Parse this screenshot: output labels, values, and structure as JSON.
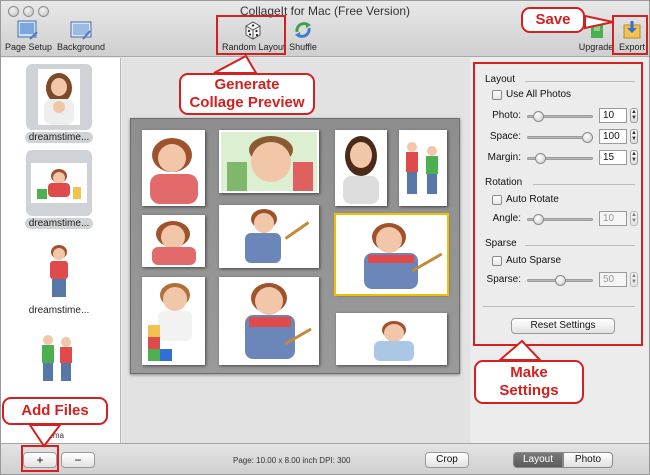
{
  "window": {
    "title": "CollageIt for Mac (Free Version)"
  },
  "toolbar": {
    "page_setup": "Page Setup",
    "background": "Background",
    "random_layout": "Random Layout",
    "shuffle": "Shuffle",
    "upgrade": "Upgrade",
    "export": "Export"
  },
  "sidebar": {
    "items": [
      {
        "label": "dreamstime..."
      },
      {
        "label": "dreamstime..."
      },
      {
        "label": "dreamstime..."
      }
    ],
    "count_label": "6 Ima",
    "add_button": "+",
    "remove_button": "−"
  },
  "settings": {
    "layout_header": "Layout",
    "use_all_photos": "Use All Photos",
    "photo_label": "Photo:",
    "photo_value": "10",
    "photo_level": 0.1,
    "space_label": "Space:",
    "space_value": "100",
    "space_level": 1.0,
    "margin_label": "Margin:",
    "margin_value": "15",
    "margin_level": 0.15,
    "rotation_header": "Rotation",
    "auto_rotate": "Auto Rotate",
    "angle_label": "Angle:",
    "angle_value": "10",
    "angle_level": 0.1,
    "sparse_header": "Sparse",
    "auto_sparse": "Auto Sparse",
    "sparse_label": "Sparse:",
    "sparse_value": "50",
    "sparse_level": 0.5,
    "reset_button": "Reset Settings"
  },
  "bottombar": {
    "page_info": "Page: 10.00 x 8.00 inch DPI: 300",
    "crop_button": "Crop",
    "layout_tab": "Layout",
    "photo_tab": "Photo"
  },
  "annotations": {
    "save": "Save",
    "generate_line1": "Generate",
    "generate_line2": "Collage Preview",
    "make_line1": "Make",
    "make_line2": "Settings",
    "add_files": "Add Files"
  },
  "colors": {
    "annotation_red": "#d32020",
    "selection_yellow": "#f0c000",
    "active_tab": "#5a5a5a"
  }
}
